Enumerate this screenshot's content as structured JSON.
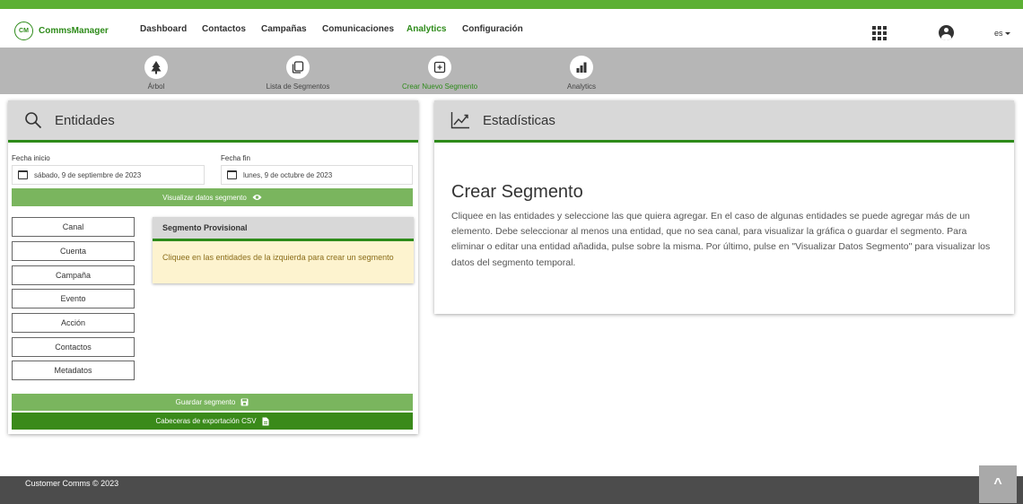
{
  "brand": {
    "logo_mark": "CM",
    "name": "CommsManager",
    "accent_color": "#2e8b1a",
    "top_strip_color": "#5cb034"
  },
  "nav": {
    "items": [
      {
        "label": "Dashboard"
      },
      {
        "label": "Contactos"
      },
      {
        "label": "Campañas"
      },
      {
        "label": "Comunicaciones"
      },
      {
        "label": "Analytics",
        "active": true
      },
      {
        "label": "Configuración"
      }
    ],
    "language": "es"
  },
  "subnav": {
    "items": [
      {
        "label": "Árbol",
        "icon": "tree-icon"
      },
      {
        "label": "Lista de Segmentos",
        "icon": "list-segments-icon"
      },
      {
        "label": "Crear Nuevo Segmento",
        "icon": "new-segment-icon",
        "active": true
      },
      {
        "label": "Analytics",
        "icon": "bar-chart-icon"
      }
    ]
  },
  "entities_panel": {
    "title": "Entidades",
    "icon": "search-icon",
    "start_date": {
      "label": "Fecha inicio",
      "value": "sábado, 9 de septiembre de 2023"
    },
    "end_date": {
      "label": "Fecha fin",
      "value": "lunes, 9 de octubre de 2023"
    },
    "view_button": "Visualizar datos segmento",
    "entities": [
      "Canal",
      "Cuenta",
      "Campaña",
      "Evento",
      "Acción",
      "Contactos",
      "Metadatos"
    ],
    "provisional": {
      "title": "Segmento Provisional",
      "message": "Cliquee en las entidades de la izquierda para crear un segmento"
    },
    "save_button": "Guardar segmento",
    "csv_button": "Cabeceras de exportación CSV"
  },
  "stats_panel": {
    "title": "Estadísticas",
    "icon": "line-chart-icon",
    "heading": "Crear Segmento",
    "text": "Cliquee en las entidades y seleccione las que quiera agregar. En el caso de algunas entidades se puede agregar más de un elemento. Debe seleccionar al menos una entidad, que no sea canal, para visualizar la gráfica o guardar el segmento. Para eliminar o editar una entidad añadida, pulse sobre la misma. Por último, pulse en \"Visualizar Datos Segmento\" para visualizar los datos del segmento temporal."
  },
  "footer": {
    "text": "Customer Comms © 2023",
    "scroll_top_label": "^"
  }
}
